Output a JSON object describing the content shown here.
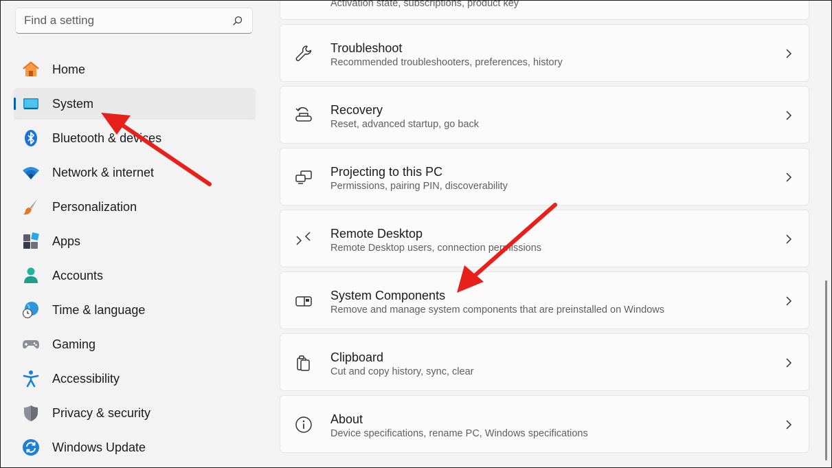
{
  "search": {
    "placeholder": "Find a setting",
    "icon": "search-icon"
  },
  "nav": {
    "items": [
      {
        "label": "Home",
        "icon": "home-icon"
      },
      {
        "label": "System",
        "icon": "system-icon",
        "active": true
      },
      {
        "label": "Bluetooth & devices",
        "icon": "bluetooth-icon"
      },
      {
        "label": "Network & internet",
        "icon": "wifi-icon"
      },
      {
        "label": "Personalization",
        "icon": "brush-icon"
      },
      {
        "label": "Apps",
        "icon": "apps-icon"
      },
      {
        "label": "Accounts",
        "icon": "accounts-icon"
      },
      {
        "label": "Time & language",
        "icon": "globe-clock-icon"
      },
      {
        "label": "Gaming",
        "icon": "gamepad-icon"
      },
      {
        "label": "Accessibility",
        "icon": "accessibility-icon"
      },
      {
        "label": "Privacy & security",
        "icon": "shield-icon"
      },
      {
        "label": "Windows Update",
        "icon": "update-icon"
      }
    ]
  },
  "cards": {
    "items": [
      {
        "title": "",
        "subtitle": "Activation state, subscriptions, product key"
      },
      {
        "title": "Troubleshoot",
        "subtitle": "Recommended troubleshooters, preferences, history",
        "icon": "wrench-icon"
      },
      {
        "title": "Recovery",
        "subtitle": "Reset, advanced startup, go back",
        "icon": "recovery-icon"
      },
      {
        "title": "Projecting to this PC",
        "subtitle": "Permissions, pairing PIN, discoverability",
        "icon": "projecting-icon"
      },
      {
        "title": "Remote Desktop",
        "subtitle": "Remote Desktop users, connection permissions",
        "icon": "remote-desktop-icon"
      },
      {
        "title": "System Components",
        "subtitle": "Remove and manage system components that are preinstalled on Windows",
        "icon": "system-components-icon"
      },
      {
        "title": "Clipboard",
        "subtitle": "Cut and copy history, sync, clear",
        "icon": "clipboard-icon"
      },
      {
        "title": "About",
        "subtitle": "Device specifications, rename PC, Windows specifications",
        "icon": "info-icon"
      }
    ]
  },
  "colors": {
    "accent": "#005fb8",
    "annotation_arrow": "#e8201c",
    "background": "#f3f3f3",
    "card": "#fbfbfb"
  }
}
